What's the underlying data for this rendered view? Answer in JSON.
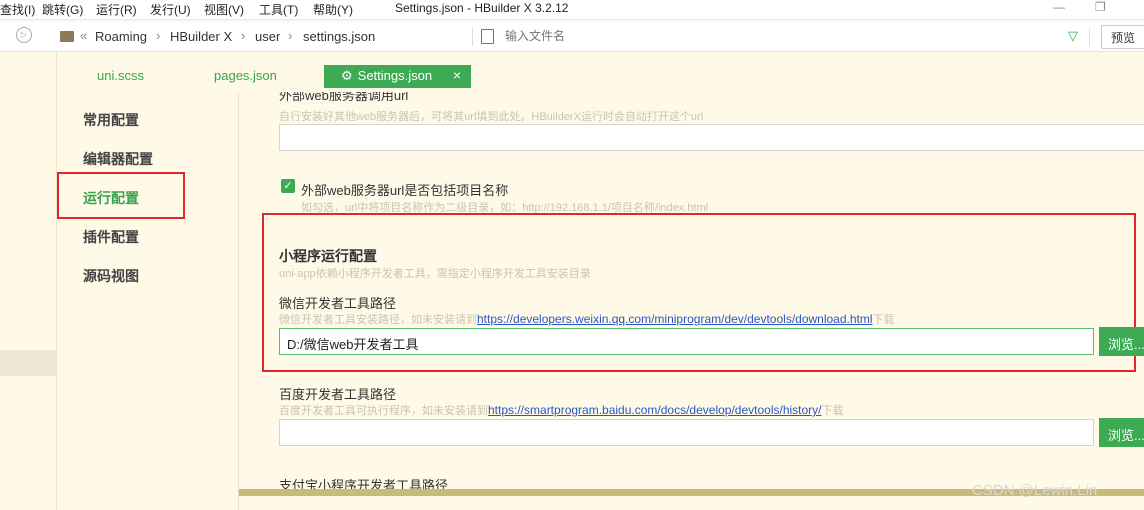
{
  "menubar": {
    "items": [
      "查找(I)",
      "跳转(G)",
      "运行(R)",
      "发行(U)",
      "视图(V)",
      "工具(T)",
      "帮助(Y)"
    ],
    "title": "Settings.json - HBuilder X 3.2.12"
  },
  "addressbar": {
    "breadcrumbs": [
      "Roaming",
      "HBuilder X",
      "user",
      "settings.json"
    ],
    "search_placeholder": "输入文件名",
    "preview_label": "预览"
  },
  "tabs": {
    "items": [
      "uni.scss",
      "pages.json"
    ],
    "active": "Settings.json"
  },
  "nav": {
    "items": [
      "常用配置",
      "编辑器配置",
      "运行配置",
      "插件配置",
      "源码视图"
    ],
    "active_index": 2
  },
  "content": {
    "web_server_title_partial": "外部web服务器调用url",
    "web_server_hint": "自行安装好其他web服务器后，可将其url填到此处。HBuilderX运行时会自动打开这个url",
    "web_server_value": "",
    "include_project_label": "外部web服务器url是否包括项目名称",
    "include_project_checked": true,
    "include_project_hint": "如勾选，url中将项目名称作为二级目录，如：http://192.168.1.1/项目名称/index.html",
    "mp_heading": "小程序运行配置",
    "mp_hint": "uni-app依赖小程序开发者工具，需指定小程序开发工具安装目录",
    "wechat": {
      "label": "微信开发者工具路径",
      "hint_prefix": "微信开发者工具安装路径，如未安装请到",
      "link": "https://developers.weixin.qq.com/miniprogram/dev/devtools/download.html",
      "hint_suffix": "下载",
      "value": "D:/微信web开发者工具",
      "browse": "浏览..."
    },
    "baidu": {
      "label": "百度开发者工具路径",
      "hint_prefix": "百度开发者工具可执行程序，如未安装请到",
      "link": "https://smartprogram.baidu.com/docs/develop/devtools/history/",
      "hint_suffix": "下载",
      "value": "",
      "browse": "浏览..."
    },
    "alipay_label": "支付宝小程序开发者工具路径"
  },
  "watermark": "CSDN @Lewin.Lin",
  "colors": {
    "accent": "#3daa54",
    "highlight_box": "#e0262e",
    "background": "#fffae8",
    "link": "#2a55c9"
  }
}
